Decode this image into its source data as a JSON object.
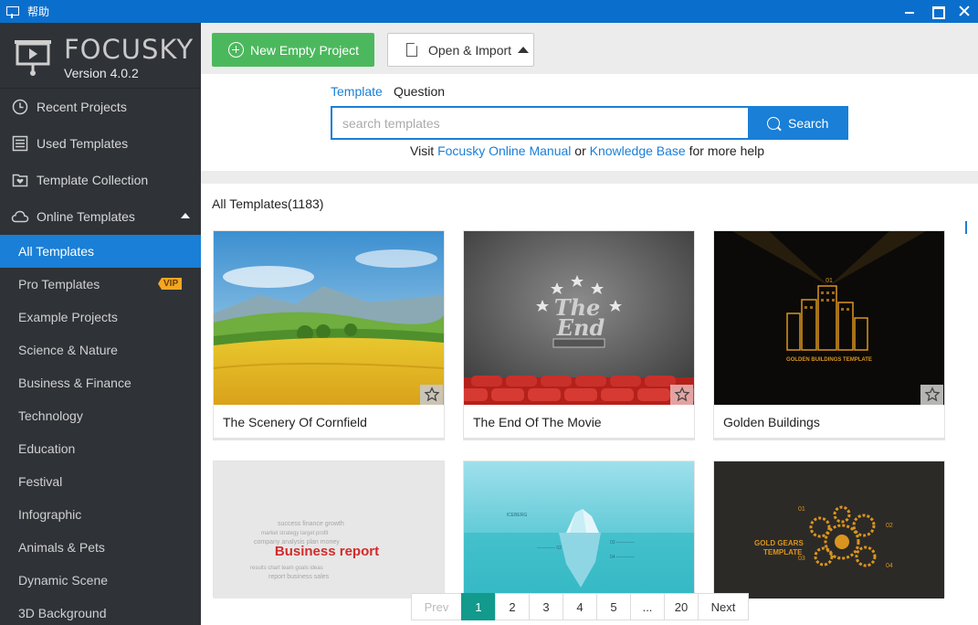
{
  "window": {
    "title": "帮助"
  },
  "brand": {
    "name": "FOCUSKY",
    "version": "Version 4.0.2"
  },
  "nav_main": [
    {
      "label": "Recent Projects",
      "icon": "clock-icon"
    },
    {
      "label": "Used Templates",
      "icon": "list-icon"
    },
    {
      "label": "Template Collection",
      "icon": "heart-folder-icon"
    },
    {
      "label": "Online Templates",
      "icon": "cloud-icon"
    }
  ],
  "nav_sub": [
    {
      "label": "All Templates",
      "active": true
    },
    {
      "label": "Pro Templates",
      "badge": "VIP"
    },
    {
      "label": "Example Projects"
    },
    {
      "label": "Science & Nature"
    },
    {
      "label": "Business & Finance"
    },
    {
      "label": "Technology"
    },
    {
      "label": "Education"
    },
    {
      "label": "Festival"
    },
    {
      "label": "Infographic"
    },
    {
      "label": "Animals & Pets"
    },
    {
      "label": "Dynamic Scene"
    },
    {
      "label": "3D Background"
    }
  ],
  "toolbar": {
    "new_label": "New Empty Project",
    "open_label": "Open & Import"
  },
  "search": {
    "tabs": [
      "Template",
      "Question"
    ],
    "placeholder": "search templates",
    "button_label": "Search",
    "help_prefix": "Visit ",
    "help_link1": "Focusky Online Manual",
    "help_mid": " or ",
    "help_link2": "Knowledge Base",
    "help_suffix": " for more help"
  },
  "templates": {
    "heading": "All Templates(1183)",
    "cards": [
      {
        "name": "The Scenery Of Cornfield"
      },
      {
        "name": "The End Of The Movie"
      },
      {
        "name": "Golden Buildings"
      },
      {
        "name": "",
        "thumb_text": "Business report"
      },
      {
        "name": "",
        "thumb_text": "ICEBERG"
      },
      {
        "name": "",
        "thumb_text": "GOLD GEARS TEMPLATE"
      }
    ],
    "thumb_texts": {
      "movie_title1": "The",
      "movie_title2": "End",
      "golden": "GOLDEN BUILDINGS TEMPLATE"
    }
  },
  "pagination": {
    "prev": "Prev",
    "pages": [
      "1",
      "2",
      "3",
      "4",
      "5",
      "...",
      "20"
    ],
    "current": "1",
    "next": "Next"
  },
  "colors": {
    "accent": "#1a7fd6",
    "green": "#4cb85d",
    "sidebar": "#2f3237",
    "page_active": "#129a8c"
  }
}
